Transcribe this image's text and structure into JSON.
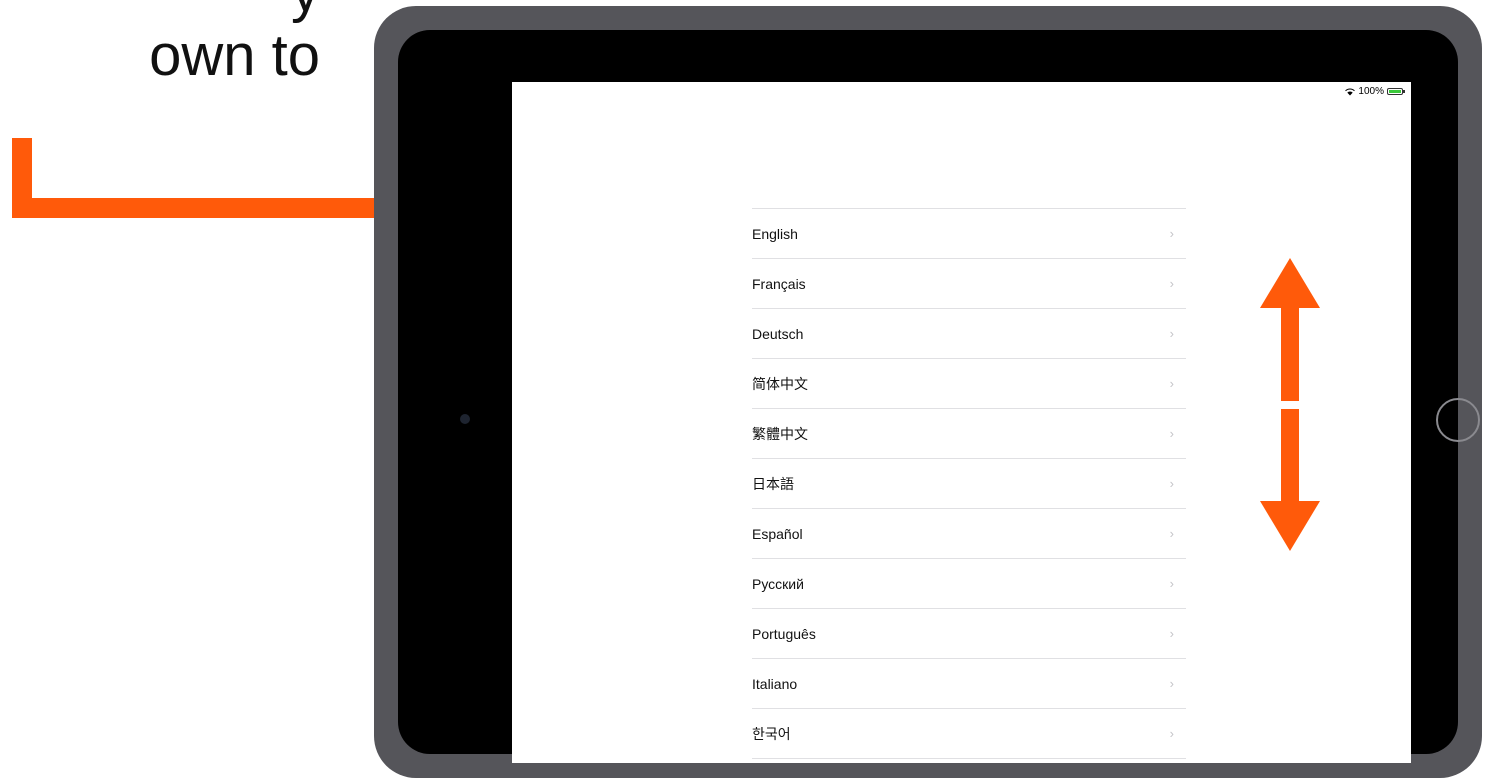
{
  "caption": {
    "line1": "y",
    "line2": "own to"
  },
  "status_bar": {
    "battery_text": "100%",
    "icons": [
      "wifi-icon",
      "battery-icon"
    ]
  },
  "languages": [
    {
      "label": "English"
    },
    {
      "label": "Français"
    },
    {
      "label": "Deutsch"
    },
    {
      "label": "简体中文"
    },
    {
      "label": "繁體中文"
    },
    {
      "label": "日本語"
    },
    {
      "label": "Español"
    },
    {
      "label": "Русский"
    },
    {
      "label": "Português"
    },
    {
      "label": "Italiano"
    },
    {
      "label": "한국어"
    }
  ],
  "colors": {
    "annotation": "#ff5a0a",
    "device_frame": "#55555a",
    "divider": "#e0e0e3"
  }
}
